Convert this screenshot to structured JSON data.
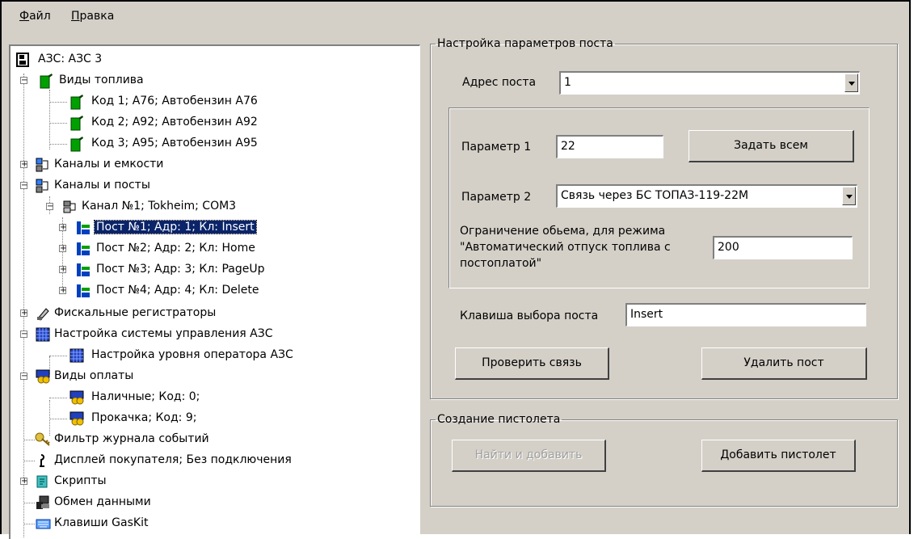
{
  "menu": {
    "file_first": "Ф",
    "file_rest": "айл",
    "edit_first": "П",
    "edit_rest": "равка"
  },
  "tree": {
    "root": "АЗС: АЗС 3",
    "fuel_types": "Виды топлива",
    "fuel_1": "Код 1; А76; Автобензин А76",
    "fuel_2": "Код 2; А92; Автобензин А92",
    "fuel_3": "Код 3; А95; Автобензин А95",
    "channels_tanks": "Каналы и емкости",
    "channels_posts": "Каналы и посты",
    "channel_1": "Канал №1; Tokheim; COM3",
    "post_1": "Пост №1; Адр: 1; Кл: Insert",
    "post_2": "Пост №2; Адр: 2; Кл: Home",
    "post_3": "Пост №3; Адр: 3; Кл: PageUp",
    "post_4": "Пост №4; Адр: 4; Кл: Delete",
    "fiscal": "Фискальные регистраторы",
    "control_setup": "Настройка системы управления АЗС",
    "operator_level": "Настройка уровня оператора АЗС",
    "payment_types": "Виды оплаты",
    "pay_cash": "Наличные; Код: 0;",
    "pay_pump": "Прокачка; Код: 9;",
    "event_filter": "Фильтр журнала событий",
    "customer_display": "Дисплей покупателя; Без подключения",
    "scripts": "Скрипты",
    "data_exchange": "Обмен данными",
    "gaskit_keys": "Клавиши GasKit"
  },
  "post_settings": {
    "legend": "Настройка параметров поста",
    "address_label": "Адрес поста",
    "address_value": "1",
    "param1_label": "Параметр 1",
    "param1_value": "22",
    "set_all_button": "Задать всем",
    "param2_label": "Параметр 2",
    "param2_value": "Связь через БС ТОПАЗ-119-22М",
    "limit_label_1": "Ограничение обьема, для режима",
    "limit_label_2": "\"Автоматический отпуск топлива с",
    "limit_label_3": "постоплатой\"",
    "limit_value": "200",
    "key_label": "Клавиша выбора поста",
    "key_value": "Insert",
    "check_button": "Проверить связь",
    "delete_button": "Удалить пост"
  },
  "nozzle": {
    "legend": "Создание пистолета",
    "find_add_button": "Найти и добавить",
    "add_button": "Добавить пистолет"
  }
}
